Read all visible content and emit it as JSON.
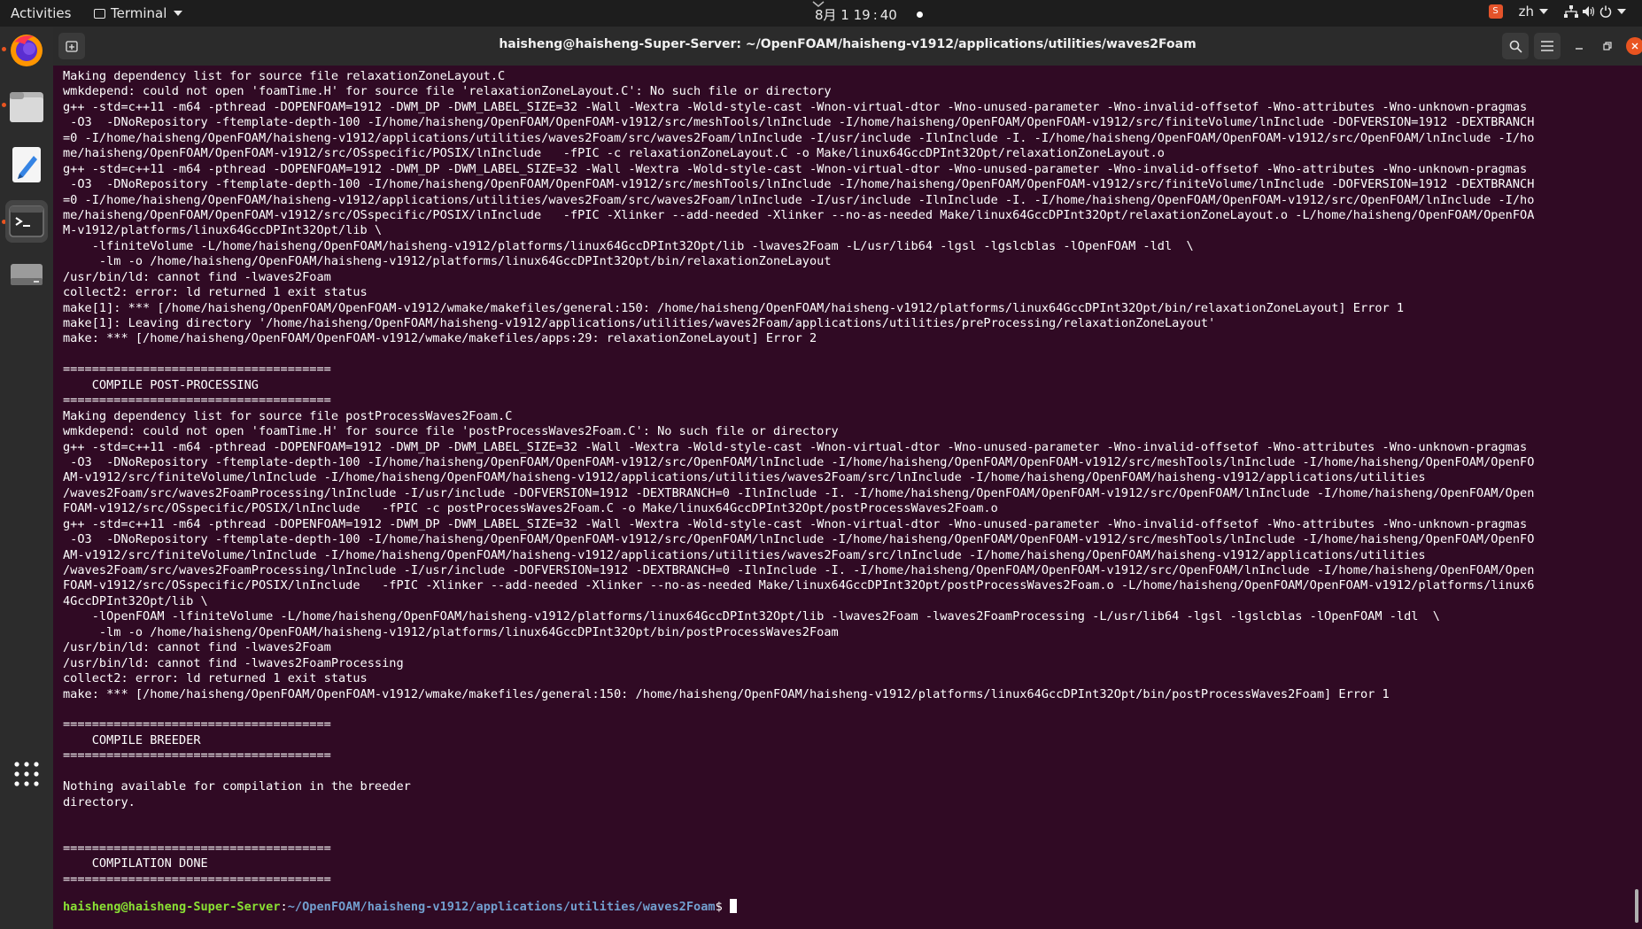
{
  "topbar": {
    "activities": "Activities",
    "app_name": "Terminal",
    "clock": "8月 1 19 : 40",
    "language": "zh"
  },
  "dock": {
    "items": [
      "Firefox",
      "Files",
      "Text Editor",
      "Terminal",
      "Drive",
      "Show Applications"
    ]
  },
  "window": {
    "title": "haisheng@haisheng-Super-Server: ~/OpenFOAM/haisheng-v1912/applications/utilities/waves2Foam"
  },
  "terminal": {
    "lines": [
      "Making dependency list for source file relaxationZoneLayout.C",
      "wmkdepend: could not open 'foamTime.H' for source file 'relaxationZoneLayout.C': No such file or directory",
      "g++ -std=c++11 -m64 -pthread -DOPENFOAM=1912 -DWM_DP -DWM_LABEL_SIZE=32 -Wall -Wextra -Wold-style-cast -Wnon-virtual-dtor -Wno-unused-parameter -Wno-invalid-offsetof -Wno-attributes -Wno-unknown-pragmas",
      " -O3  -DNoRepository -ftemplate-depth-100 -I/home/haisheng/OpenFOAM/OpenFOAM-v1912/src/meshTools/lnInclude -I/home/haisheng/OpenFOAM/OpenFOAM-v1912/src/finiteVolume/lnInclude -DOFVERSION=1912 -DEXTBRANCH",
      "=0 -I/home/haisheng/OpenFOAM/haisheng-v1912/applications/utilities/waves2Foam/src/waves2Foam/lnInclude -I/usr/include -IlnInclude -I. -I/home/haisheng/OpenFOAM/OpenFOAM-v1912/src/OpenFOAM/lnInclude -I/ho",
      "me/haisheng/OpenFOAM/OpenFOAM-v1912/src/OSspecific/POSIX/lnInclude   -fPIC -c relaxationZoneLayout.C -o Make/linux64GccDPInt32Opt/relaxationZoneLayout.o",
      "g++ -std=c++11 -m64 -pthread -DOPENFOAM=1912 -DWM_DP -DWM_LABEL_SIZE=32 -Wall -Wextra -Wold-style-cast -Wnon-virtual-dtor -Wno-unused-parameter -Wno-invalid-offsetof -Wno-attributes -Wno-unknown-pragmas",
      " -O3  -DNoRepository -ftemplate-depth-100 -I/home/haisheng/OpenFOAM/OpenFOAM-v1912/src/meshTools/lnInclude -I/home/haisheng/OpenFOAM/OpenFOAM-v1912/src/finiteVolume/lnInclude -DOFVERSION=1912 -DEXTBRANCH",
      "=0 -I/home/haisheng/OpenFOAM/haisheng-v1912/applications/utilities/waves2Foam/src/waves2Foam/lnInclude -I/usr/include -IlnInclude -I. -I/home/haisheng/OpenFOAM/OpenFOAM-v1912/src/OpenFOAM/lnInclude -I/ho",
      "me/haisheng/OpenFOAM/OpenFOAM-v1912/src/OSspecific/POSIX/lnInclude   -fPIC -Xlinker --add-needed -Xlinker --no-as-needed Make/linux64GccDPInt32Opt/relaxationZoneLayout.o -L/home/haisheng/OpenFOAM/OpenFOA",
      "M-v1912/platforms/linux64GccDPInt32Opt/lib \\",
      "    -lfiniteVolume -L/home/haisheng/OpenFOAM/haisheng-v1912/platforms/linux64GccDPInt32Opt/lib -lwaves2Foam -L/usr/lib64 -lgsl -lgslcblas -lOpenFOAM -ldl  \\",
      "     -lm -o /home/haisheng/OpenFOAM/haisheng-v1912/platforms/linux64GccDPInt32Opt/bin/relaxationZoneLayout",
      "/usr/bin/ld: cannot find -lwaves2Foam",
      "collect2: error: ld returned 1 exit status",
      "make[1]: *** [/home/haisheng/OpenFOAM/OpenFOAM-v1912/wmake/makefiles/general:150: /home/haisheng/OpenFOAM/haisheng-v1912/platforms/linux64GccDPInt32Opt/bin/relaxationZoneLayout] Error 1",
      "make[1]: Leaving directory '/home/haisheng/OpenFOAM/haisheng-v1912/applications/utilities/waves2Foam/applications/utilities/preProcessing/relaxationZoneLayout'",
      "make: *** [/home/haisheng/OpenFOAM/OpenFOAM-v1912/wmake/makefiles/apps:29: relaxationZoneLayout] Error 2",
      "",
      "=====================================",
      "    COMPILE POST-PROCESSING",
      "=====================================",
      "Making dependency list for source file postProcessWaves2Foam.C",
      "wmkdepend: could not open 'foamTime.H' for source file 'postProcessWaves2Foam.C': No such file or directory",
      "g++ -std=c++11 -m64 -pthread -DOPENFOAM=1912 -DWM_DP -DWM_LABEL_SIZE=32 -Wall -Wextra -Wold-style-cast -Wnon-virtual-dtor -Wno-unused-parameter -Wno-invalid-offsetof -Wno-attributes -Wno-unknown-pragmas",
      " -O3  -DNoRepository -ftemplate-depth-100 -I/home/haisheng/OpenFOAM/OpenFOAM-v1912/src/OpenFOAM/lnInclude -I/home/haisheng/OpenFOAM/OpenFOAM-v1912/src/meshTools/lnInclude -I/home/haisheng/OpenFOAM/OpenFO",
      "AM-v1912/src/finiteVolume/lnInclude -I/home/haisheng/OpenFOAM/haisheng-v1912/applications/utilities/waves2Foam/src/lnInclude -I/home/haisheng/OpenFOAM/haisheng-v1912/applications/utilities",
      "/waves2Foam/src/waves2FoamProcessing/lnInclude -I/usr/include -DOFVERSION=1912 -DEXTBRANCH=0 -IlnInclude -I. -I/home/haisheng/OpenFOAM/OpenFOAM-v1912/src/OpenFOAM/lnInclude -I/home/haisheng/OpenFOAM/Open",
      "FOAM-v1912/src/OSspecific/POSIX/lnInclude   -fPIC -c postProcessWaves2Foam.C -o Make/linux64GccDPInt32Opt/postProcessWaves2Foam.o",
      "g++ -std=c++11 -m64 -pthread -DOPENFOAM=1912 -DWM_DP -DWM_LABEL_SIZE=32 -Wall -Wextra -Wold-style-cast -Wnon-virtual-dtor -Wno-unused-parameter -Wno-invalid-offsetof -Wno-attributes -Wno-unknown-pragmas",
      " -O3  -DNoRepository -ftemplate-depth-100 -I/home/haisheng/OpenFOAM/OpenFOAM-v1912/src/OpenFOAM/lnInclude -I/home/haisheng/OpenFOAM/OpenFOAM-v1912/src/meshTools/lnInclude -I/home/haisheng/OpenFOAM/OpenFO",
      "AM-v1912/src/finiteVolume/lnInclude -I/home/haisheng/OpenFOAM/haisheng-v1912/applications/utilities/waves2Foam/src/lnInclude -I/home/haisheng/OpenFOAM/haisheng-v1912/applications/utilities",
      "/waves2Foam/src/waves2FoamProcessing/lnInclude -I/usr/include -DOFVERSION=1912 -DEXTBRANCH=0 -IlnInclude -I. -I/home/haisheng/OpenFOAM/OpenFOAM-v1912/src/OpenFOAM/lnInclude -I/home/haisheng/OpenFOAM/Open",
      "FOAM-v1912/src/OSspecific/POSIX/lnInclude   -fPIC -Xlinker --add-needed -Xlinker --no-as-needed Make/linux64GccDPInt32Opt/postProcessWaves2Foam.o -L/home/haisheng/OpenFOAM/OpenFOAM-v1912/platforms/linux6",
      "4GccDPInt32Opt/lib \\",
      "    -lOpenFOAM -lfiniteVolume -L/home/haisheng/OpenFOAM/haisheng-v1912/platforms/linux64GccDPInt32Opt/lib -lwaves2Foam -lwaves2FoamProcessing -L/usr/lib64 -lgsl -lgslcblas -lOpenFOAM -ldl  \\",
      "     -lm -o /home/haisheng/OpenFOAM/haisheng-v1912/platforms/linux64GccDPInt32Opt/bin/postProcessWaves2Foam",
      "/usr/bin/ld: cannot find -lwaves2Foam",
      "/usr/bin/ld: cannot find -lwaves2FoamProcessing",
      "collect2: error: ld returned 1 exit status",
      "make: *** [/home/haisheng/OpenFOAM/OpenFOAM-v1912/wmake/makefiles/general:150: /home/haisheng/OpenFOAM/haisheng-v1912/platforms/linux64GccDPInt32Opt/bin/postProcessWaves2Foam] Error 1",
      "",
      "=====================================",
      "    COMPILE BREEDER",
      "=====================================",
      "",
      "Nothing available for compilation in the breeder",
      "directory.",
      "",
      "",
      "=====================================",
      "    COMPILATION DONE",
      "====================================="
    ],
    "prompt_user": "haisheng@haisheng-Super-Server",
    "prompt_sep": ":",
    "prompt_path": "~/OpenFOAM/haisheng-v1912/applications/utilities/waves2Foam",
    "prompt_symbol": "$ "
  },
  "colors": {
    "terminal_bg": "#300a24",
    "prompt_user": "#8ae234",
    "prompt_path": "#729fcf",
    "accent": "#e95420"
  }
}
